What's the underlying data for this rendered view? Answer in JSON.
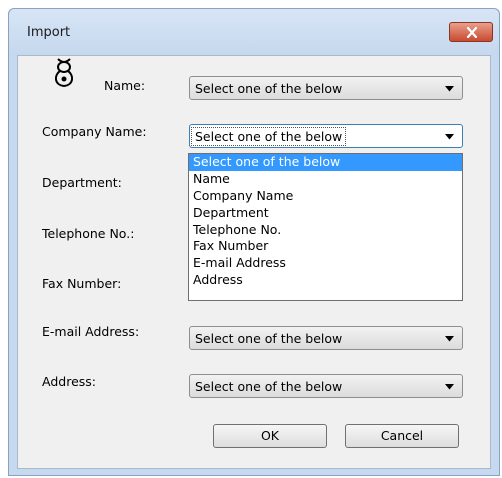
{
  "dialog": {
    "title": "Import"
  },
  "fields": [
    {
      "label": "Name:",
      "value": "Select one of the below"
    },
    {
      "label": "Company Name:",
      "value": "Select one of the below"
    },
    {
      "label": "Department:"
    },
    {
      "label": "Telephone No.:"
    },
    {
      "label": "Fax Number:"
    },
    {
      "label": "E-mail Address:",
      "value": "Select one of the below"
    },
    {
      "label": "Address:",
      "value": "Select one of the below"
    }
  ],
  "dropdown_options": [
    "Select one of the below",
    "Name",
    "Company Name",
    "Department",
    "Telephone No.",
    "Fax Number",
    "E-mail Address",
    "Address"
  ],
  "buttons": {
    "ok": "OK",
    "cancel": "Cancel"
  },
  "icons": {
    "person": "person-icon",
    "close": "close-icon",
    "dropdown": "chevron-down-icon"
  },
  "colors": {
    "selection": "#3399ff",
    "close_button": "#c94a32"
  }
}
